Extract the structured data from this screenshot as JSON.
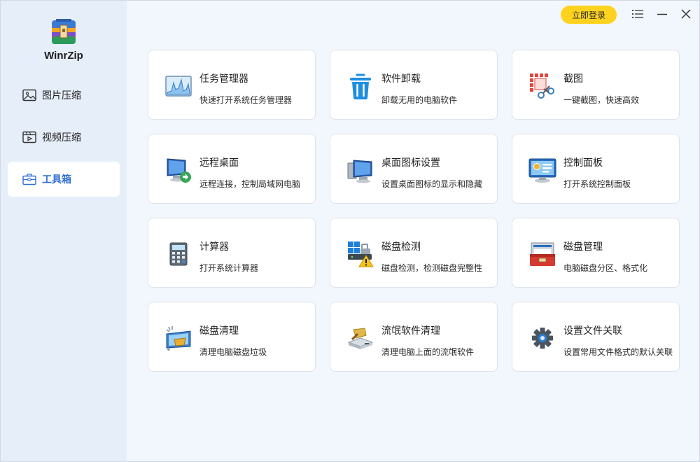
{
  "app": {
    "name": "WinrZip"
  },
  "titlebar": {
    "login_label": "立即登录"
  },
  "sidebar": {
    "items": [
      {
        "label": "图片压缩",
        "icon": "image-icon",
        "active": false
      },
      {
        "label": "视频压缩",
        "icon": "video-icon",
        "active": false
      },
      {
        "label": "工具箱",
        "icon": "toolbox-icon",
        "active": true
      }
    ]
  },
  "tools": [
    {
      "title": "任务管理器",
      "desc": "快速打开系统任务管理器",
      "icon": "task-manager-icon"
    },
    {
      "title": "软件卸载",
      "desc": "卸载无用的电脑软件",
      "icon": "trash-icon"
    },
    {
      "title": "截图",
      "desc": "一键截图，快速高效",
      "icon": "screenshot-icon"
    },
    {
      "title": "远程桌面",
      "desc": "远程连接，控制局域网电脑",
      "icon": "remote-desktop-icon"
    },
    {
      "title": "桌面图标设置",
      "desc": "设置桌面图标的显示和隐藏",
      "icon": "desktop-icons-icon"
    },
    {
      "title": "控制面板",
      "desc": "打开系统控制面板",
      "icon": "control-panel-icon"
    },
    {
      "title": "计算器",
      "desc": "打开系统计算器",
      "icon": "calculator-icon"
    },
    {
      "title": "磁盘检测",
      "desc": "磁盘检测，检测磁盘完整性",
      "icon": "disk-check-icon"
    },
    {
      "title": "磁盘管理",
      "desc": "电脑磁盘分区、格式化",
      "icon": "disk-management-icon"
    },
    {
      "title": "磁盘清理",
      "desc": "清理电脑磁盘垃圾",
      "icon": "disk-cleanup-icon"
    },
    {
      "title": "流氓软件清理",
      "desc": "清理电脑上面的流氓软件",
      "icon": "rogue-software-icon"
    },
    {
      "title": "设置文件关联",
      "desc": "设置常用文件格式的默认关联",
      "icon": "gear-icon"
    }
  ],
  "colors": {
    "accent": "#2f6fd6",
    "login_button": "#ffd21f",
    "sidebar_bg": "#e6eff9",
    "content_bg": "#f2f7fd"
  }
}
